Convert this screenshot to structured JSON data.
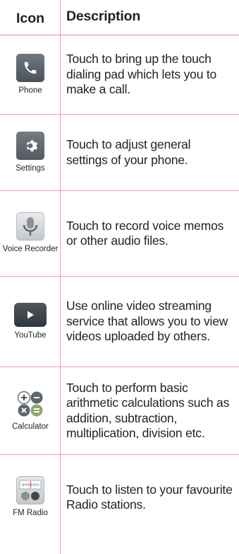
{
  "table": {
    "header": {
      "icon_col": "Icon",
      "desc_col": "Description"
    },
    "rows": [
      {
        "icon_name": "phone-icon",
        "label": "Phone",
        "description": "Touch to bring up the touch dialing pad which lets you to make a call."
      },
      {
        "icon_name": "settings-gear-icon",
        "label": "Settings",
        "description": "Touch to adjust general settings of your phone."
      },
      {
        "icon_name": "voice-recorder-microphone-icon",
        "label": "Voice Recorder",
        "description": "Touch to record voice memos or other audio files."
      },
      {
        "icon_name": "youtube-play-icon",
        "label": "YouTube",
        "description": "Use online video streaming service that allows you to view videos uploaded by others."
      },
      {
        "icon_name": "calculator-icon",
        "label": "Calculator",
        "description": "Touch to perform basic arithmetic calculations such as addition, subtraction, multiplication, division etc."
      },
      {
        "icon_name": "fm-radio-icon",
        "label": "FM Radio",
        "description": "Touch to listen to your favourite Radio stations."
      }
    ]
  },
  "colors": {
    "rule": "#e3a1b4",
    "text": "#231f20"
  }
}
